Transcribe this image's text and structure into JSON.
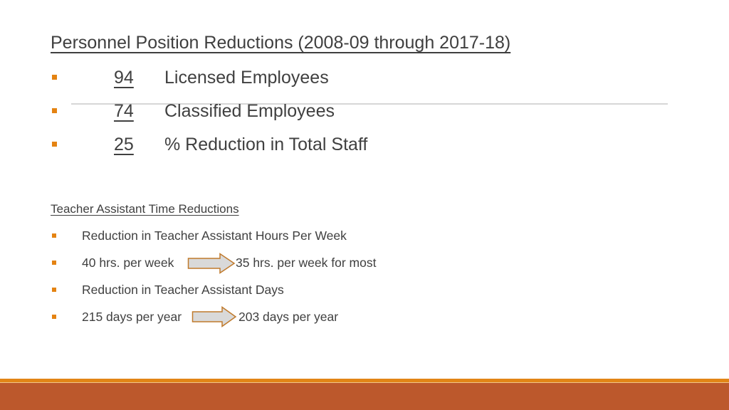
{
  "slide": {
    "title": "Personnel Position Reductions (2008-09 through 2017-18)",
    "personnel_items": [
      {
        "number": "94",
        "label": "Licensed Employees"
      },
      {
        "number": "74",
        "label": "Classified Employees"
      },
      {
        "number": "25",
        "label": "% Reduction in Total Staff"
      }
    ],
    "section_title": "Teacher Assistant Time Reductions",
    "ta_items": [
      {
        "text": "Reduction in Teacher Assistant Hours Per Week"
      },
      {
        "from": "40 hrs. per week",
        "to": "35 hrs. per week for most",
        "icon": "right-arrow-icon"
      },
      {
        "text": "Reduction in Teacher Assistant Days"
      },
      {
        "from": "215 days per year",
        "to": "203 days per year",
        "icon": "right-arrow-icon"
      }
    ]
  },
  "colors": {
    "bullet": "#e48312",
    "arrow_fill": "#d9d9d9",
    "arrow_stroke": "#c07a2c",
    "footer_stripe": "#e28516",
    "footer_band": "#bc582c",
    "text": "#404040"
  }
}
